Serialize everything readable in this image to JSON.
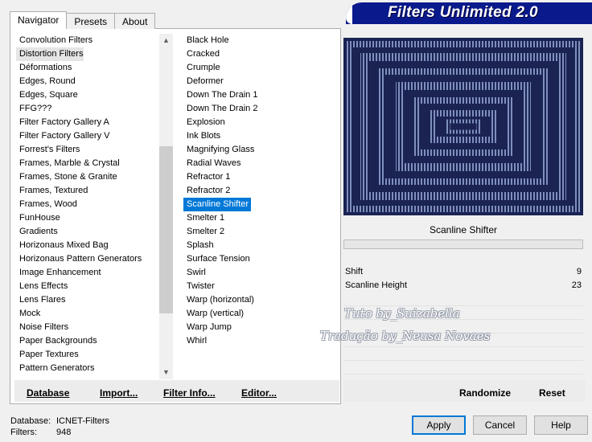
{
  "tabs": [
    {
      "label": "Navigator"
    },
    {
      "label": "Presets"
    },
    {
      "label": "About"
    }
  ],
  "banner": {
    "title": "Filters Unlimited 2.0"
  },
  "categories": {
    "selected": "Distortion Filters",
    "items": [
      "Convolution Filters",
      "Distortion Filters",
      "Déformations",
      "Edges, Round",
      "Edges, Square",
      "FFG???",
      "Filter Factory Gallery A",
      "Filter Factory Gallery V",
      "Forrest's Filters",
      "Frames, Marble & Crystal",
      "Frames, Stone & Granite",
      "Frames, Textured",
      "Frames, Wood",
      "FunHouse",
      "Gradients",
      "Horizonaus Mixed Bag",
      "Horizonaus Pattern Generators",
      "Image Enhancement",
      "Lens Effects",
      "Lens Flares",
      "Mock",
      "Noise Filters",
      "Paper Backgrounds",
      "Paper Textures",
      "Pattern Generators"
    ]
  },
  "filters": {
    "selected": "Scanline Shifter",
    "items": [
      "Black Hole",
      "Cracked",
      "Crumple",
      "Deformer",
      "Down The Drain 1",
      "Down The Drain 2",
      "Explosion",
      "Ink Blots",
      "Magnifying Glass",
      "Radial Waves",
      "Refractor 1",
      "Refractor 2",
      "Scanline Shifter",
      "Smelter 1",
      "Smelter 2",
      "Splash",
      "Surface Tension",
      "Swirl",
      "Twister",
      "Warp (horizontal)",
      "Warp (vertical)",
      "Warp Jump",
      "Whirl"
    ]
  },
  "left_buttons": {
    "database": "Database",
    "import": "Import...",
    "filter_info": "Filter Info...",
    "editor": "Editor..."
  },
  "preview": {
    "filter_name": "Scanline Shifter"
  },
  "parameters": [
    {
      "label": "Shift",
      "value": "9"
    },
    {
      "label": "Scanline Height",
      "value": "23"
    }
  ],
  "watermarks": {
    "line1": "Tuto by_Suizabella",
    "line2": "Tradução by_Neusa Novaes"
  },
  "right_buttons": {
    "randomize": "Randomize",
    "reset": "Reset"
  },
  "status": {
    "database_label": "Database:",
    "database_value": "ICNET-Filters",
    "filters_label": "Filters:",
    "filters_value": "948"
  },
  "dialog_buttons": {
    "apply": "Apply",
    "cancel": "Cancel",
    "help": "Help"
  },
  "colors": {
    "accent": "#0078d7",
    "banner": "#0a1a8c",
    "preview_bg": "#1a2352"
  }
}
